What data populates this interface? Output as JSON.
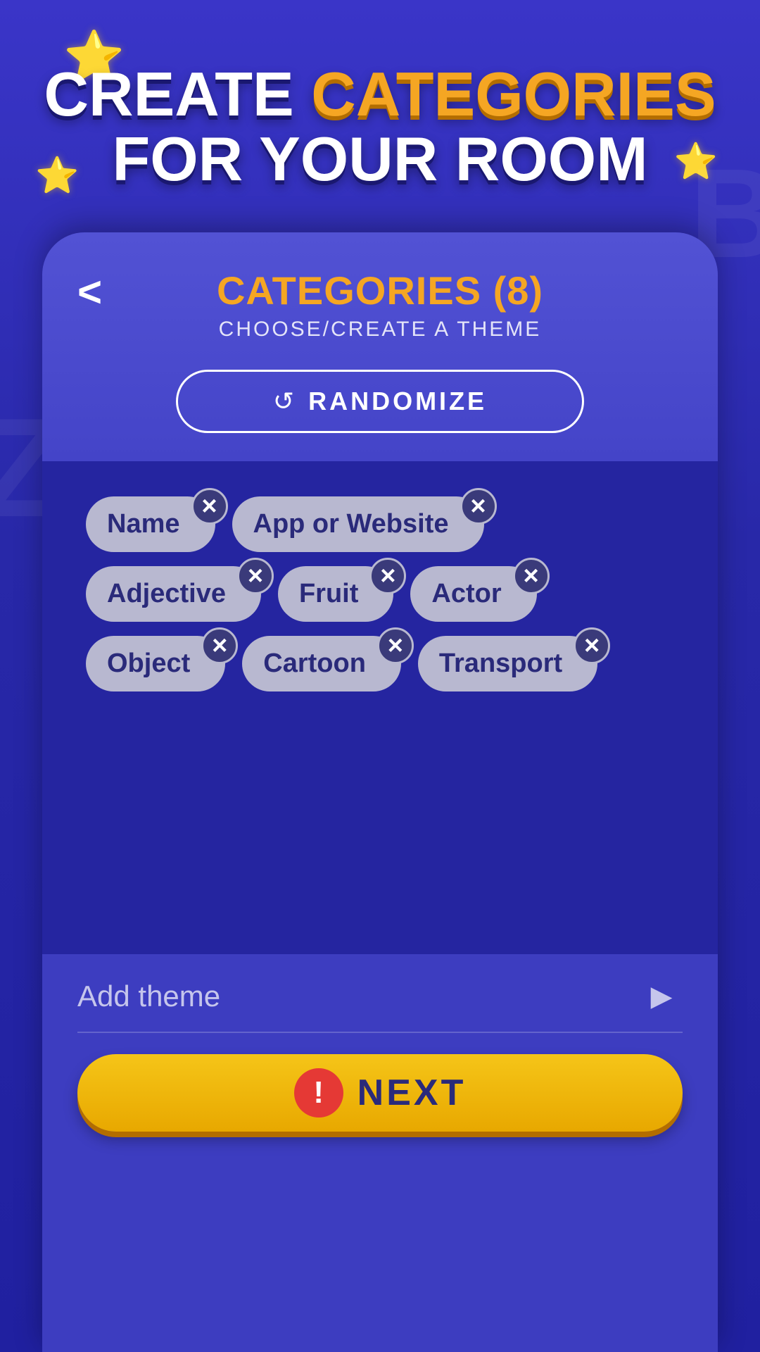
{
  "background": {
    "color": "#2d2ab5"
  },
  "stars": [
    "⭐",
    "⭐",
    "⭐"
  ],
  "watermarks": [
    "B",
    "Z"
  ],
  "title": {
    "line1_white": "CREATE",
    "line1_gold": "CATEGORIES",
    "line2": "FOR YOUR ROOM"
  },
  "card": {
    "title": "CATEGORIES (8)",
    "subtitle": "CHOOSE/CREATE A THEME",
    "back_label": "<",
    "randomize_label": "RANDOMIZE"
  },
  "categories": [
    {
      "label": "Name"
    },
    {
      "label": "App or Website"
    },
    {
      "label": "Adjective"
    },
    {
      "label": "Fruit"
    },
    {
      "label": "Actor"
    },
    {
      "label": "Object"
    },
    {
      "label": "Cartoon"
    },
    {
      "label": "Transport"
    }
  ],
  "bottom": {
    "add_theme_label": "Add theme",
    "next_label": "NEXT",
    "warning_symbol": "!"
  }
}
